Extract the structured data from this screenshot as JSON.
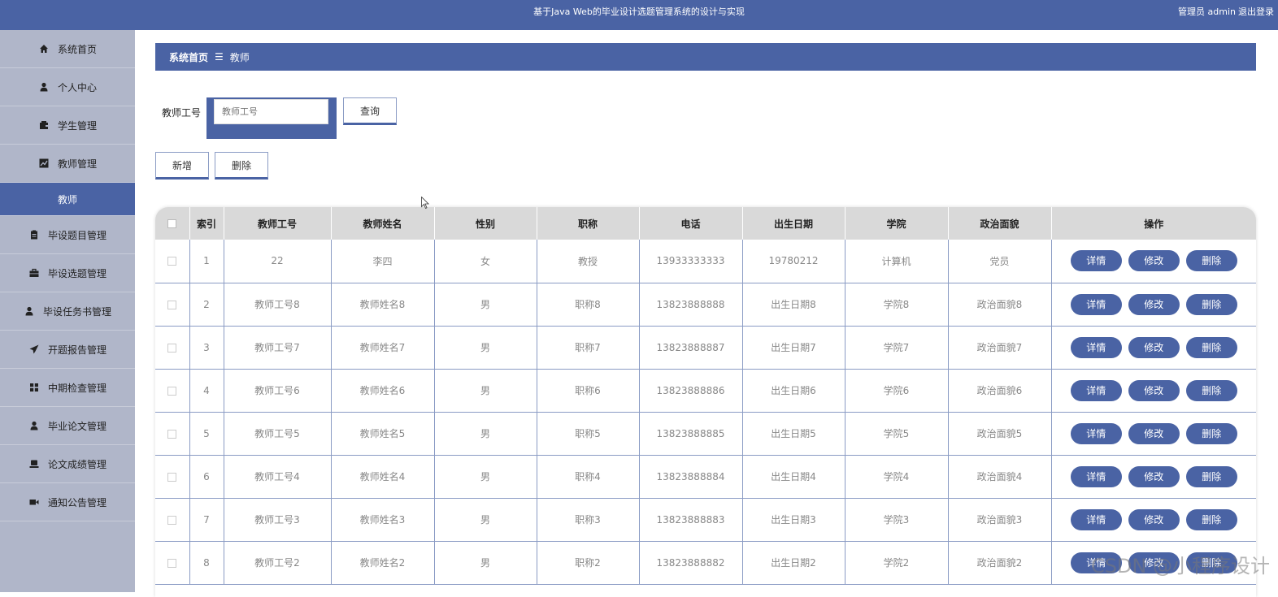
{
  "header": {
    "title": "基于Java Web的毕业设计选题管理系统的设计与实现",
    "user": "管理员 admin",
    "logout": "退出登录"
  },
  "sidebar": {
    "items": [
      {
        "label": "系统首页",
        "icon": "home-icon"
      },
      {
        "label": "个人中心",
        "icon": "user-icon"
      },
      {
        "label": "学生管理",
        "icon": "wallet-icon"
      },
      {
        "label": "教师管理",
        "icon": "chart-icon"
      },
      {
        "label": "教师",
        "icon": ""
      },
      {
        "label": "毕设题目管理",
        "icon": "clipboard-icon"
      },
      {
        "label": "毕设选题管理",
        "icon": "briefcase-icon"
      },
      {
        "label": "毕设任务书管理",
        "icon": "user-tie-icon"
      },
      {
        "label": "开题报告管理",
        "icon": "paper-plane-icon"
      },
      {
        "label": "中期检查管理",
        "icon": "grid-icon"
      },
      {
        "label": "毕业论文管理",
        "icon": "user-icon"
      },
      {
        "label": "论文成绩管理",
        "icon": "laptop-icon"
      },
      {
        "label": "通知公告管理",
        "icon": "video-icon"
      }
    ]
  },
  "breadcrumb": {
    "home": "系统首页",
    "separator": "☰",
    "current": "教师"
  },
  "search": {
    "label": "教师工号",
    "placeholder": "教师工号",
    "button": "查询"
  },
  "actions": {
    "add": "新增",
    "delete": "删除"
  },
  "table": {
    "headers": [
      "索引",
      "教师工号",
      "教师姓名",
      "性别",
      "职称",
      "电话",
      "出生日期",
      "学院",
      "政治面貌",
      "操作"
    ],
    "op_labels": {
      "detail": "详情",
      "edit": "修改",
      "delete": "删除"
    },
    "rows": [
      [
        "1",
        "22",
        "李四",
        "女",
        "教授",
        "13933333333",
        "19780212",
        "计算机",
        "党员"
      ],
      [
        "2",
        "教师工号8",
        "教师姓名8",
        "男",
        "职称8",
        "13823888888",
        "出生日期8",
        "学院8",
        "政治面貌8"
      ],
      [
        "3",
        "教师工号7",
        "教师姓名7",
        "男",
        "职称7",
        "13823888887",
        "出生日期7",
        "学院7",
        "政治面貌7"
      ],
      [
        "4",
        "教师工号6",
        "教师姓名6",
        "男",
        "职称6",
        "13823888886",
        "出生日期6",
        "学院6",
        "政治面貌6"
      ],
      [
        "5",
        "教师工号5",
        "教师姓名5",
        "男",
        "职称5",
        "13823888885",
        "出生日期5",
        "学院5",
        "政治面貌5"
      ],
      [
        "6",
        "教师工号4",
        "教师姓名4",
        "男",
        "职称4",
        "13823888884",
        "出生日期4",
        "学院4",
        "政治面貌4"
      ],
      [
        "7",
        "教师工号3",
        "教师姓名3",
        "男",
        "职称3",
        "13823888883",
        "出生日期3",
        "学院3",
        "政治面貌3"
      ],
      [
        "8",
        "教师工号2",
        "教师姓名2",
        "男",
        "职称2",
        "13823888882",
        "出生日期2",
        "学院2",
        "政治面貌2"
      ]
    ]
  },
  "watermark": "CSDN @小程序设计",
  "colors": {
    "primary": "#4a63a4",
    "sidebar": "#b0b6c9",
    "header_row": "#d9d9d9"
  }
}
